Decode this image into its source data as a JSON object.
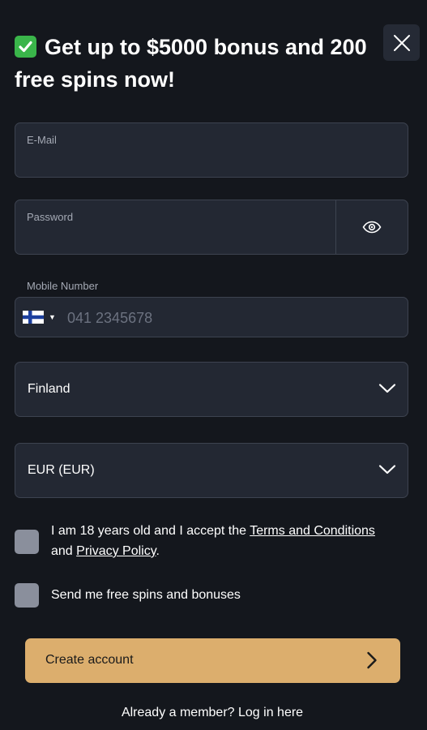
{
  "header": {
    "title": "Get up to $5000 bonus and 200 free spins now!",
    "check_icon": "check-mark-icon",
    "close_icon": "close-icon"
  },
  "form": {
    "email": {
      "label": "E-Mail",
      "value": ""
    },
    "password": {
      "label": "Password",
      "value": "",
      "toggle_icon": "eye-icon"
    },
    "mobile": {
      "label": "Mobile Number",
      "country_flag": "finland-flag-icon",
      "placeholder": "041 2345678",
      "value": ""
    },
    "country": {
      "value": "Finland"
    },
    "currency": {
      "value": "EUR (EUR)"
    },
    "terms": {
      "text_before": "I am 18 years old and I accept the ",
      "terms_link": "Terms and Conditions",
      "text_and": " and ",
      "privacy_link": "Privacy Policy",
      "text_end": "."
    },
    "promo": {
      "text": "Send me free spins and bonuses"
    },
    "submit": {
      "label": "Create account",
      "arrow_icon": "chevron-right-icon"
    },
    "login_prompt": "Already a member? Log in here"
  },
  "colors": {
    "background": "#14171d",
    "field": "#232833",
    "border": "#3d4350",
    "accent": "#dcae6d",
    "check_green": "#3ab54a"
  }
}
